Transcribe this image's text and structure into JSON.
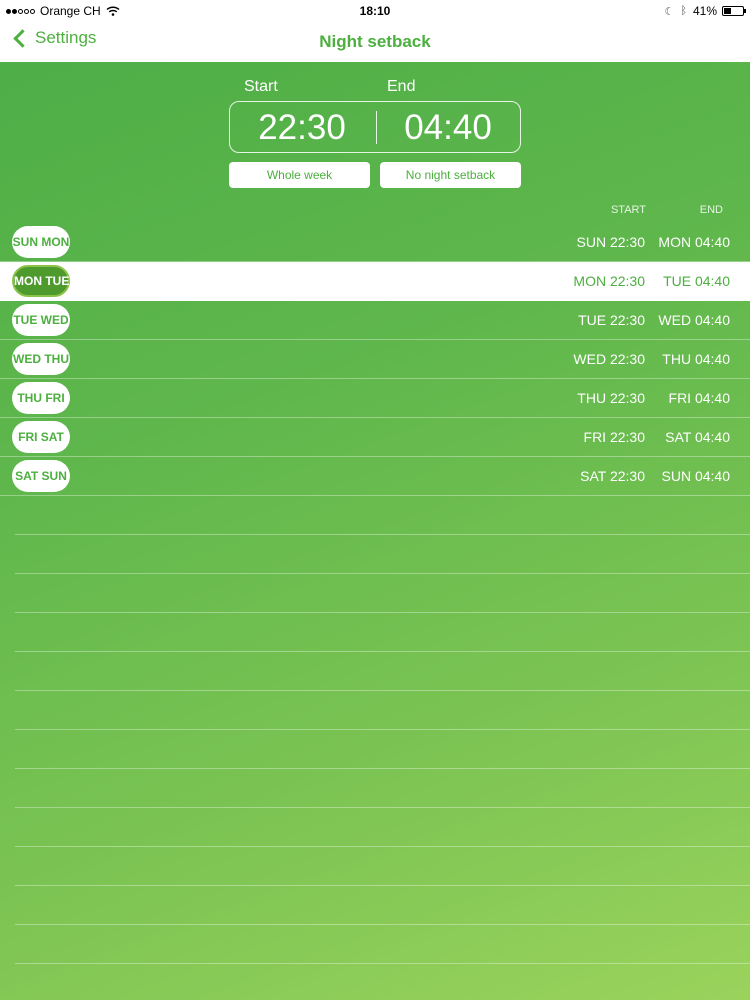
{
  "status": {
    "carrier": "Orange CH",
    "time": "18:10",
    "battery": "41%",
    "battery_level": 0.41,
    "signal_bars": 2
  },
  "nav": {
    "back_label": "Settings",
    "title": "Night setback"
  },
  "setback": {
    "start_label": "Start",
    "end_label": "End",
    "start_time": "22:30",
    "end_time": "04:40",
    "whole_week_label": "Whole week",
    "no_setback_label": "No night setback"
  },
  "columns": {
    "start": "START",
    "end": "END"
  },
  "days": [
    {
      "label": "SUN MON",
      "start": "SUN 22:30",
      "end": "MON 04:40",
      "selected": false
    },
    {
      "label": "MON TUE",
      "start": "MON 22:30",
      "end": "TUE 04:40",
      "selected": true
    },
    {
      "label": "TUE WED",
      "start": "TUE 22:30",
      "end": "WED 04:40",
      "selected": false
    },
    {
      "label": "WED THU",
      "start": "WED 22:30",
      "end": "THU 04:40",
      "selected": false
    },
    {
      "label": "THU FRI",
      "start": "THU 22:30",
      "end": "FRI 04:40",
      "selected": false
    },
    {
      "label": "FRI SAT",
      "start": "FRI 22:30",
      "end": "SAT 04:40",
      "selected": false
    },
    {
      "label": "SAT SUN",
      "start": "SAT 22:30",
      "end": "SUN 04:40",
      "selected": false
    }
  ],
  "colors": {
    "accent": "#4caf3f",
    "background_start": "#4eae47",
    "background_end": "#9ad35c"
  },
  "icons": {
    "back": "chevron-left-icon",
    "wifi": "wifi-icon",
    "moon": "moon-icon",
    "bluetooth": "bluetooth-icon",
    "battery": "battery-icon"
  }
}
